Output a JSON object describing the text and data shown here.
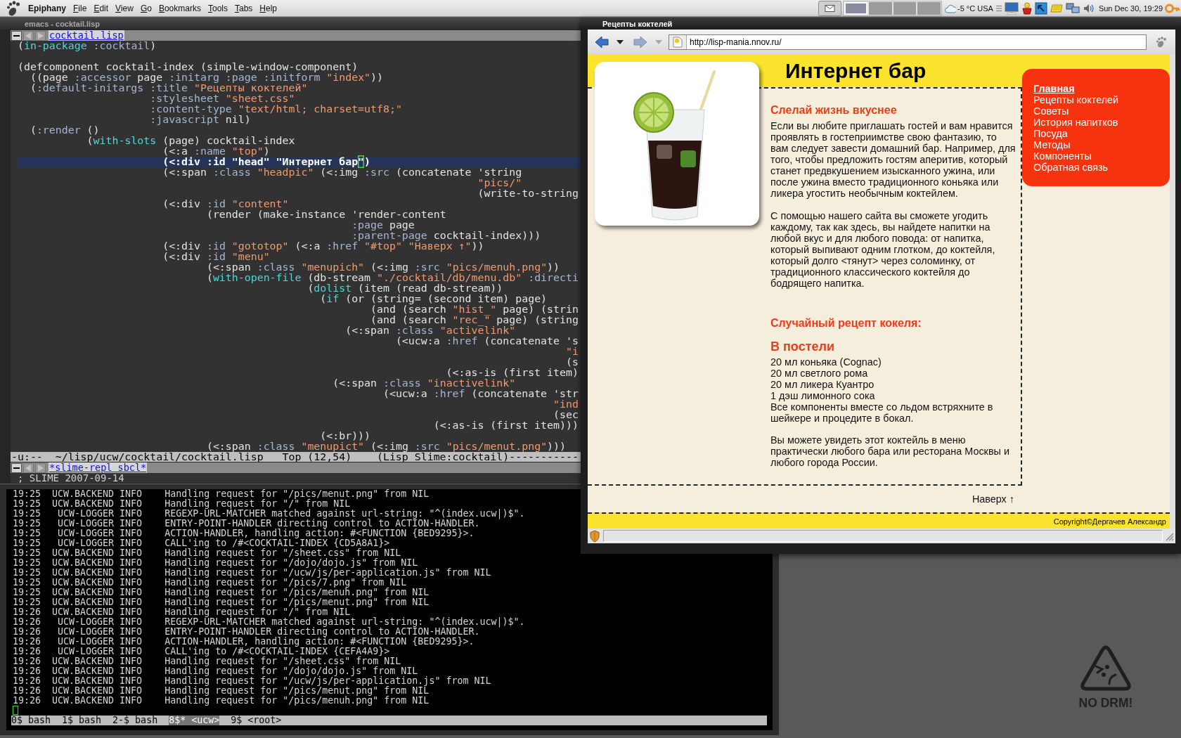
{
  "top_panel": {
    "app_name": "Epiphany",
    "menus": [
      "File",
      "Edit",
      "View",
      "Go",
      "Bookmarks",
      "Tools",
      "Tabs",
      "Help"
    ],
    "workspaces": [
      {
        "selected": true
      },
      {
        "selected": false
      },
      {
        "selected": false
      },
      {
        "selected": false
      }
    ],
    "weather": "-5 °C USA",
    "clock": "Sun Dec 30, 19:29"
  },
  "emacs": {
    "title": "emacs - cocktail.lisp",
    "buffer_tab": "cocktail.lisp",
    "code_lines": [
      {
        "highlighted": false,
        "segments": [
          {
            "kind": "plain",
            "text": "("
          },
          {
            "kind": "builtin",
            "text": "in-package"
          },
          {
            "kind": "keyword",
            "text": " :cocktail"
          },
          {
            "kind": "plain",
            "text": ")"
          }
        ]
      },
      {
        "highlighted": false
      },
      {
        "highlighted": false,
        "segments": [
          {
            "kind": "plain",
            "text": "(defcomponent cocktail-index (simple-window-component)"
          }
        ]
      },
      {
        "highlighted": false,
        "segments": [
          {
            "kind": "plain",
            "text": "  ((page "
          },
          {
            "kind": "keyword",
            "text": ":accessor"
          },
          {
            "kind": "plain",
            "text": " page "
          },
          {
            "kind": "keyword",
            "text": ":initarg"
          },
          {
            "kind": "keyword",
            "text": " :page"
          },
          {
            "kind": "keyword",
            "text": " :initform"
          },
          {
            "kind": "string",
            "text": " \"index\""
          },
          {
            "kind": "plain",
            "text": "))"
          }
        ]
      },
      {
        "highlighted": false,
        "segments": [
          {
            "kind": "plain",
            "text": "  ("
          },
          {
            "kind": "keyword",
            "text": ":default-initargs"
          },
          {
            "kind": "keyword",
            "text": " :title"
          },
          {
            "kind": "string",
            "text": " \"Рецепты коктелей\""
          }
        ]
      },
      {
        "highlighted": false,
        "segments": [
          {
            "kind": "keyword",
            "text": "                     :stylesheet"
          },
          {
            "kind": "string",
            "text": " \"sheet.css\""
          }
        ]
      },
      {
        "highlighted": false,
        "segments": [
          {
            "kind": "keyword",
            "text": "                     :content-type"
          },
          {
            "kind": "string",
            "text": " \"text/html; charset=utf8;\""
          }
        ]
      },
      {
        "highlighted": false,
        "segments": [
          {
            "kind": "keyword",
            "text": "                     :javascript"
          },
          {
            "kind": "plain",
            "text": " nil)"
          }
        ]
      },
      {
        "highlighted": false,
        "segments": [
          {
            "kind": "plain",
            "text": "  ("
          },
          {
            "kind": "keyword",
            "text": ":render"
          },
          {
            "kind": "plain",
            "text": " ()"
          }
        ]
      },
      {
        "highlighted": false,
        "segments": [
          {
            "kind": "plain",
            "text": "           ("
          },
          {
            "kind": "builtin",
            "text": "with-slots"
          },
          {
            "kind": "plain",
            "text": " (page) cocktail-index"
          }
        ]
      },
      {
        "highlighted": false,
        "segments": [
          {
            "kind": "plain",
            "text": "                       (<:a "
          },
          {
            "kind": "keyword",
            "text": ":name"
          },
          {
            "kind": "string",
            "text": " \"top\""
          },
          {
            "kind": "plain",
            "text": ")"
          }
        ]
      },
      {
        "highlighted": true,
        "segments": [
          {
            "kind": "plain",
            "text": "                       (<:div :id \"head\" \"Интернет бар"
          },
          {
            "kind": "cursor",
            "text": "\""
          },
          {
            "kind": "plain",
            "text": ")"
          }
        ]
      },
      {
        "highlighted": false,
        "segments": [
          {
            "kind": "plain",
            "text": "                       (<:span "
          },
          {
            "kind": "keyword",
            "text": ":class"
          },
          {
            "kind": "string",
            "text": " \"headpic\""
          },
          {
            "kind": "plain",
            "text": " (<:img "
          },
          {
            "kind": "keyword",
            "text": ":src"
          },
          {
            "kind": "plain",
            "text": " (concatenate 'string"
          }
        ]
      },
      {
        "highlighted": false,
        "segments": [
          {
            "kind": "string",
            "text": "                                                                         \"pics/\""
          }
        ]
      },
      {
        "highlighted": false,
        "segments": [
          {
            "kind": "plain",
            "text": "                                                                         (write-to-string"
          }
        ]
      },
      {
        "highlighted": false,
        "segments": [
          {
            "kind": "plain",
            "text": "                       (<:div "
          },
          {
            "kind": "keyword",
            "text": ":id"
          },
          {
            "kind": "string",
            "text": " \"content\""
          }
        ]
      },
      {
        "highlighted": false,
        "segments": [
          {
            "kind": "plain",
            "text": "                              (render (make-instance 'render-content"
          }
        ]
      },
      {
        "highlighted": false,
        "segments": [
          {
            "kind": "keyword",
            "text": "                                                     :page"
          },
          {
            "kind": "plain",
            "text": " page"
          }
        ]
      },
      {
        "highlighted": false,
        "segments": [
          {
            "kind": "keyword",
            "text": "                                                     :parent-page"
          },
          {
            "kind": "plain",
            "text": " cocktail-index)))"
          }
        ]
      },
      {
        "highlighted": false,
        "segments": [
          {
            "kind": "plain",
            "text": "                       (<:div "
          },
          {
            "kind": "keyword",
            "text": ":id"
          },
          {
            "kind": "string",
            "text": " \"gototop\""
          },
          {
            "kind": "plain",
            "text": " (<:a "
          },
          {
            "kind": "keyword",
            "text": ":href"
          },
          {
            "kind": "string",
            "text": " \"#top\""
          },
          {
            "kind": "string",
            "text": " \"Наверх ↑\""
          },
          {
            "kind": "plain",
            "text": "))"
          }
        ]
      },
      {
        "highlighted": false,
        "segments": [
          {
            "kind": "plain",
            "text": "                       (<:div "
          },
          {
            "kind": "keyword",
            "text": ":id"
          },
          {
            "kind": "string",
            "text": " \"menu\""
          }
        ]
      },
      {
        "highlighted": false,
        "segments": [
          {
            "kind": "plain",
            "text": "                              (<:span "
          },
          {
            "kind": "keyword",
            "text": ":class"
          },
          {
            "kind": "string",
            "text": " \"menupich\""
          },
          {
            "kind": "plain",
            "text": " (<:img "
          },
          {
            "kind": "keyword",
            "text": ":src"
          },
          {
            "kind": "string",
            "text": " \"pics/menuh.png\""
          },
          {
            "kind": "plain",
            "text": "))"
          }
        ]
      },
      {
        "highlighted": false,
        "segments": [
          {
            "kind": "plain",
            "text": "                              ("
          },
          {
            "kind": "builtin",
            "text": "with-open-file"
          },
          {
            "kind": "plain",
            "text": " (db-stream "
          },
          {
            "kind": "string",
            "text": "\"./cocktail/db/menu.db\""
          },
          {
            "kind": "keyword",
            "text": " :directi"
          }
        ]
      },
      {
        "highlighted": false,
        "segments": [
          {
            "kind": "plain",
            "text": "                                              ("
          },
          {
            "kind": "builtin",
            "text": "dolist"
          },
          {
            "kind": "plain",
            "text": " (item (read db-stream))"
          }
        ]
      },
      {
        "highlighted": false,
        "segments": [
          {
            "kind": "plain",
            "text": "                                                ("
          },
          {
            "kind": "builtin",
            "text": "if"
          },
          {
            "kind": "plain",
            "text": " (or (string= (second item) page)"
          }
        ]
      },
      {
        "highlighted": false,
        "segments": [
          {
            "kind": "plain",
            "text": "                                                        (and (search "
          },
          {
            "kind": "string",
            "text": "\"hist_\""
          },
          {
            "kind": "plain",
            "text": " page) (strin"
          }
        ]
      },
      {
        "highlighted": false,
        "segments": [
          {
            "kind": "plain",
            "text": "                                                        (and (search "
          },
          {
            "kind": "string",
            "text": "\"rec_\""
          },
          {
            "kind": "plain",
            "text": " page) (string"
          }
        ]
      },
      {
        "highlighted": false,
        "segments": [
          {
            "kind": "plain",
            "text": "                                                    (<:span "
          },
          {
            "kind": "keyword",
            "text": ":class"
          },
          {
            "kind": "string",
            "text": " \"activelink\""
          }
        ]
      },
      {
        "highlighted": false,
        "segments": [
          {
            "kind": "plain",
            "text": "                                                            (<ucw:a "
          },
          {
            "kind": "keyword",
            "text": ":href"
          },
          {
            "kind": "plain",
            "text": " (concatenate 's"
          }
        ]
      },
      {
        "highlighted": false,
        "segments": [
          {
            "kind": "string",
            "text": "                                                                                       \"i"
          }
        ]
      },
      {
        "highlighted": false,
        "segments": [
          {
            "kind": "plain",
            "text": "                                                                                       (s"
          }
        ]
      },
      {
        "highlighted": false,
        "segments": [
          {
            "kind": "plain",
            "text": "                                                                    (<:as-is (first item)"
          }
        ]
      },
      {
        "highlighted": false,
        "segments": [
          {
            "kind": "plain",
            "text": "                                                  (<:span "
          },
          {
            "kind": "keyword",
            "text": ":class"
          },
          {
            "kind": "string",
            "text": " \"inactivelink\""
          }
        ]
      },
      {
        "highlighted": false,
        "segments": [
          {
            "kind": "plain",
            "text": "                                                          (<ucw:a "
          },
          {
            "kind": "keyword",
            "text": ":href"
          },
          {
            "kind": "plain",
            "text": " (concatenate 'str"
          }
        ]
      },
      {
        "highlighted": false,
        "segments": [
          {
            "kind": "string",
            "text": "                                                                                     \"ind"
          }
        ]
      },
      {
        "highlighted": false,
        "segments": [
          {
            "kind": "plain",
            "text": "                                                                                     (sec"
          }
        ]
      },
      {
        "highlighted": false,
        "segments": [
          {
            "kind": "plain",
            "text": "                                                                  (<:as-is (first item)))"
          }
        ]
      },
      {
        "highlighted": false,
        "segments": [
          {
            "kind": "plain",
            "text": "                                                (<:br)))"
          }
        ]
      },
      {
        "highlighted": false,
        "segments": [
          {
            "kind": "plain",
            "text": "                              (<:span "
          },
          {
            "kind": "keyword",
            "text": ":class"
          },
          {
            "kind": "string",
            "text": " \"menupict\""
          },
          {
            "kind": "plain",
            "text": " (<:img "
          },
          {
            "kind": "keyword",
            "text": ":src"
          },
          {
            "kind": "string",
            "text": " \"pics/menut.png\""
          },
          {
            "kind": "plain",
            "text": ")))"
          }
        ]
      }
    ],
    "mode_line": "-u:--  ~/lisp/ucw/cocktail/cocktail.lisp   Top (12,54)    (Lisp Slime:cocktail)-----------",
    "repl_tab": "*slime-repl sbcl*",
    "repl_text": "; SLIME 2007-09-14"
  },
  "terminal": {
    "log": [
      {
        "time": "19:25",
        "logger": "UCW.BACKEND",
        "level": "INFO",
        "message": "Handling request for \"/pics/menut.png\" from NIL"
      },
      {
        "time": "19:25",
        "logger": "UCW.BACKEND",
        "level": "INFO",
        "message": "Handling request for \"/\" from NIL"
      },
      {
        "time": "19:25",
        "logger": "UCW-LOGGER",
        "level": "INFO",
        "message": "REGEXP-URL-MATCHER matched against url-string: \"^(index.ucw|)$\"."
      },
      {
        "time": "19:25",
        "logger": "UCW-LOGGER",
        "level": "INFO",
        "message": "ENTRY-POINT-HANDLER directing control to ACTION-HANDLER."
      },
      {
        "time": "19:25",
        "logger": "UCW-LOGGER",
        "level": "INFO",
        "message": "ACTION-HANDLER, handling action: #<FUNCTION {BED9295}>."
      },
      {
        "time": "19:25",
        "logger": "UCW-LOGGER",
        "level": "INFO",
        "message": "CALL'ing to /#<COCKTAIL-INDEX {CD5A8A1}>"
      },
      {
        "time": "19:25",
        "logger": "UCW.BACKEND",
        "level": "INFO",
        "message": "Handling request for \"/sheet.css\" from NIL"
      },
      {
        "time": "19:25",
        "logger": "UCW.BACKEND",
        "level": "INFO",
        "message": "Handling request for \"/dojo/dojo.js\" from NIL"
      },
      {
        "time": "19:25",
        "logger": "UCW.BACKEND",
        "level": "INFO",
        "message": "Handling request for \"/ucw/js/per-application.js\" from NIL"
      },
      {
        "time": "19:25",
        "logger": "UCW.BACKEND",
        "level": "INFO",
        "message": "Handling request for \"/pics/7.png\" from NIL"
      },
      {
        "time": "19:25",
        "logger": "UCW.BACKEND",
        "level": "INFO",
        "message": "Handling request for \"/pics/menuh.png\" from NIL"
      },
      {
        "time": "19:25",
        "logger": "UCW.BACKEND",
        "level": "INFO",
        "message": "Handling request for \"/pics/menut.png\" from NIL"
      },
      {
        "time": "19:26",
        "logger": "UCW.BACKEND",
        "level": "INFO",
        "message": "Handling request for \"/\" from NIL"
      },
      {
        "time": "19:26",
        "logger": "UCW-LOGGER",
        "level": "INFO",
        "message": "REGEXP-URL-MATCHER matched against url-string: \"^(index.ucw|)$\"."
      },
      {
        "time": "19:26",
        "logger": "UCW-LOGGER",
        "level": "INFO",
        "message": "ENTRY-POINT-HANDLER directing control to ACTION-HANDLER."
      },
      {
        "time": "19:26",
        "logger": "UCW-LOGGER",
        "level": "INFO",
        "message": "ACTION-HANDLER, handling action: #<FUNCTION {BED9295}>."
      },
      {
        "time": "19:26",
        "logger": "UCW-LOGGER",
        "level": "INFO",
        "message": "CALL'ing to /#<COCKTAIL-INDEX {CEFA4A9}>"
      },
      {
        "time": "19:26",
        "logger": "UCW.BACKEND",
        "level": "INFO",
        "message": "Handling request for \"/sheet.css\" from NIL"
      },
      {
        "time": "19:26",
        "logger": "UCW.BACKEND",
        "level": "INFO",
        "message": "Handling request for \"/dojo/dojo.js\" from NIL"
      },
      {
        "time": "19:26",
        "logger": "UCW.BACKEND",
        "level": "INFO",
        "message": "Handling request for \"/ucw/js/per-application.js\" from NIL"
      },
      {
        "time": "19:26",
        "logger": "UCW.BACKEND",
        "level": "INFO",
        "message": "Handling request for \"/pics/menut.png\" from NIL"
      },
      {
        "time": "19:26",
        "logger": "UCW.BACKEND",
        "level": "INFO",
        "message": "Handling request for \"/pics/menuh.png\" from NIL"
      }
    ],
    "windows": [
      {
        "label": "0$ bash",
        "selected": false
      },
      {
        "label": "1$ bash",
        "selected": false
      },
      {
        "label": "2-$ bash",
        "selected": false
      },
      {
        "label": "8$* <ucw>",
        "selected": true
      },
      {
        "label": "9$ <root>",
        "selected": false
      }
    ]
  },
  "browser": {
    "title": "Рецепты коктелей",
    "nav_buttons": [
      {
        "kind": "back",
        "disabled": false
      },
      {
        "kind": "forward",
        "disabled": true
      }
    ],
    "url": "http://lisp-mania.nnov.ru/",
    "page": {
      "heading": "Интернет бар",
      "intro_title": "Слелай жизнь вкуснее",
      "paragraphs": [
        "Если вы любите приглашать гостей и вам нравится проявлять в гостеприимстве свою фантазию, то вам следует завести домашний бар. Например, для того, чтобы предложить гостям аперитив, который станет предвкушением изысканного ужина, или после ужина вместо традиционного коньяка или ликера угостить необычным коктейлем.",
        "С помощью нашего сайта вы сможете угодить каждому, так как здесь, вы найдете напитки на любой вкус и для любого повода: от напитка, который выпивают одним глотком, до коктейля, который долго <тянут> через соломинку, от традиционного классического коктейля до бодрящего напитка."
      ],
      "random_title": "Случайный рецепт кокеля:",
      "recipe_name": "В постели",
      "recipe_lines": [
        "20 мл коньяка (Cognac)",
        "20 мл светлого рома",
        "20 мл ликера Куантро",
        "1 дэш лимонного сока",
        "Все компоненты вместе со льдом встряхните в шейкере и процедите в бокал."
      ],
      "recipe_note": "Вы можете увидеть этот коктейль в меню практически любого бара или ресторана Москвы и любого города России.",
      "menu": [
        {
          "label": "Главная",
          "selected": true
        },
        {
          "label": "Рецепты коктелей",
          "selected": false
        },
        {
          "label": "Советы",
          "selected": false
        },
        {
          "label": "История напитков",
          "selected": false
        },
        {
          "label": "Посуда",
          "selected": false
        },
        {
          "label": "Методы",
          "selected": false
        },
        {
          "label": "Компоненты",
          "selected": false
        },
        {
          "label": "Обратная связь",
          "selected": false
        }
      ],
      "top_link": "Наверх ↑",
      "copyright": "Copyright©Дергачев Александр"
    }
  },
  "desktop": {
    "logo_text": "NO DRM!"
  }
}
